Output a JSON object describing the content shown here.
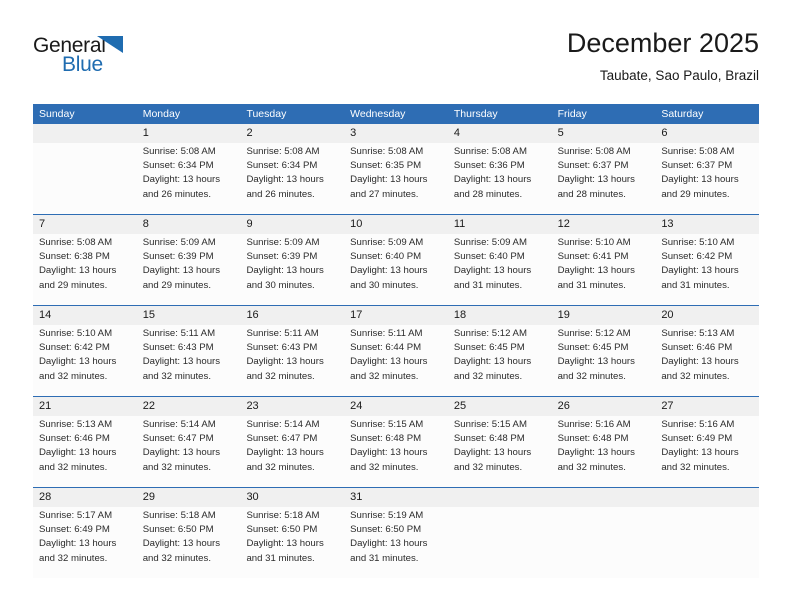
{
  "logo": {
    "word_top": "General",
    "word_bottom": "Blue",
    "triangle_icon": "triangle-icon",
    "color": "#1f6cb0"
  },
  "header": {
    "title": "December 2025",
    "location": "Taubate, Sao Paulo, Brazil"
  },
  "theme": {
    "accent": "#2e6db4",
    "daynum_band": "#f0f0f0",
    "cell_bg": "#fcfcfc",
    "header_text": "#ffffff"
  },
  "calendar": {
    "weekdays": [
      "Sunday",
      "Monday",
      "Tuesday",
      "Wednesday",
      "Thursday",
      "Friday",
      "Saturday"
    ],
    "weeks": [
      [
        {
          "day": "",
          "lines": []
        },
        {
          "day": "1",
          "lines": [
            "Sunrise: 5:08 AM",
            "Sunset: 6:34 PM",
            "Daylight: 13 hours",
            "and 26 minutes."
          ]
        },
        {
          "day": "2",
          "lines": [
            "Sunrise: 5:08 AM",
            "Sunset: 6:34 PM",
            "Daylight: 13 hours",
            "and 26 minutes."
          ]
        },
        {
          "day": "3",
          "lines": [
            "Sunrise: 5:08 AM",
            "Sunset: 6:35 PM",
            "Daylight: 13 hours",
            "and 27 minutes."
          ]
        },
        {
          "day": "4",
          "lines": [
            "Sunrise: 5:08 AM",
            "Sunset: 6:36 PM",
            "Daylight: 13 hours",
            "and 28 minutes."
          ]
        },
        {
          "day": "5",
          "lines": [
            "Sunrise: 5:08 AM",
            "Sunset: 6:37 PM",
            "Daylight: 13 hours",
            "and 28 minutes."
          ]
        },
        {
          "day": "6",
          "lines": [
            "Sunrise: 5:08 AM",
            "Sunset: 6:37 PM",
            "Daylight: 13 hours",
            "and 29 minutes."
          ]
        }
      ],
      [
        {
          "day": "7",
          "lines": [
            "Sunrise: 5:08 AM",
            "Sunset: 6:38 PM",
            "Daylight: 13 hours",
            "and 29 minutes."
          ]
        },
        {
          "day": "8",
          "lines": [
            "Sunrise: 5:09 AM",
            "Sunset: 6:39 PM",
            "Daylight: 13 hours",
            "and 29 minutes."
          ]
        },
        {
          "day": "9",
          "lines": [
            "Sunrise: 5:09 AM",
            "Sunset: 6:39 PM",
            "Daylight: 13 hours",
            "and 30 minutes."
          ]
        },
        {
          "day": "10",
          "lines": [
            "Sunrise: 5:09 AM",
            "Sunset: 6:40 PM",
            "Daylight: 13 hours",
            "and 30 minutes."
          ]
        },
        {
          "day": "11",
          "lines": [
            "Sunrise: 5:09 AM",
            "Sunset: 6:40 PM",
            "Daylight: 13 hours",
            "and 31 minutes."
          ]
        },
        {
          "day": "12",
          "lines": [
            "Sunrise: 5:10 AM",
            "Sunset: 6:41 PM",
            "Daylight: 13 hours",
            "and 31 minutes."
          ]
        },
        {
          "day": "13",
          "lines": [
            "Sunrise: 5:10 AM",
            "Sunset: 6:42 PM",
            "Daylight: 13 hours",
            "and 31 minutes."
          ]
        }
      ],
      [
        {
          "day": "14",
          "lines": [
            "Sunrise: 5:10 AM",
            "Sunset: 6:42 PM",
            "Daylight: 13 hours",
            "and 32 minutes."
          ]
        },
        {
          "day": "15",
          "lines": [
            "Sunrise: 5:11 AM",
            "Sunset: 6:43 PM",
            "Daylight: 13 hours",
            "and 32 minutes."
          ]
        },
        {
          "day": "16",
          "lines": [
            "Sunrise: 5:11 AM",
            "Sunset: 6:43 PM",
            "Daylight: 13 hours",
            "and 32 minutes."
          ]
        },
        {
          "day": "17",
          "lines": [
            "Sunrise: 5:11 AM",
            "Sunset: 6:44 PM",
            "Daylight: 13 hours",
            "and 32 minutes."
          ]
        },
        {
          "day": "18",
          "lines": [
            "Sunrise: 5:12 AM",
            "Sunset: 6:45 PM",
            "Daylight: 13 hours",
            "and 32 minutes."
          ]
        },
        {
          "day": "19",
          "lines": [
            "Sunrise: 5:12 AM",
            "Sunset: 6:45 PM",
            "Daylight: 13 hours",
            "and 32 minutes."
          ]
        },
        {
          "day": "20",
          "lines": [
            "Sunrise: 5:13 AM",
            "Sunset: 6:46 PM",
            "Daylight: 13 hours",
            "and 32 minutes."
          ]
        }
      ],
      [
        {
          "day": "21",
          "lines": [
            "Sunrise: 5:13 AM",
            "Sunset: 6:46 PM",
            "Daylight: 13 hours",
            "and 32 minutes."
          ]
        },
        {
          "day": "22",
          "lines": [
            "Sunrise: 5:14 AM",
            "Sunset: 6:47 PM",
            "Daylight: 13 hours",
            "and 32 minutes."
          ]
        },
        {
          "day": "23",
          "lines": [
            "Sunrise: 5:14 AM",
            "Sunset: 6:47 PM",
            "Daylight: 13 hours",
            "and 32 minutes."
          ]
        },
        {
          "day": "24",
          "lines": [
            "Sunrise: 5:15 AM",
            "Sunset: 6:48 PM",
            "Daylight: 13 hours",
            "and 32 minutes."
          ]
        },
        {
          "day": "25",
          "lines": [
            "Sunrise: 5:15 AM",
            "Sunset: 6:48 PM",
            "Daylight: 13 hours",
            "and 32 minutes."
          ]
        },
        {
          "day": "26",
          "lines": [
            "Sunrise: 5:16 AM",
            "Sunset: 6:48 PM",
            "Daylight: 13 hours",
            "and 32 minutes."
          ]
        },
        {
          "day": "27",
          "lines": [
            "Sunrise: 5:16 AM",
            "Sunset: 6:49 PM",
            "Daylight: 13 hours",
            "and 32 minutes."
          ]
        }
      ],
      [
        {
          "day": "28",
          "lines": [
            "Sunrise: 5:17 AM",
            "Sunset: 6:49 PM",
            "Daylight: 13 hours",
            "and 32 minutes."
          ]
        },
        {
          "day": "29",
          "lines": [
            "Sunrise: 5:18 AM",
            "Sunset: 6:50 PM",
            "Daylight: 13 hours",
            "and 32 minutes."
          ]
        },
        {
          "day": "30",
          "lines": [
            "Sunrise: 5:18 AM",
            "Sunset: 6:50 PM",
            "Daylight: 13 hours",
            "and 31 minutes."
          ]
        },
        {
          "day": "31",
          "lines": [
            "Sunrise: 5:19 AM",
            "Sunset: 6:50 PM",
            "Daylight: 13 hours",
            "and 31 minutes."
          ]
        },
        {
          "day": "",
          "lines": []
        },
        {
          "day": "",
          "lines": []
        },
        {
          "day": "",
          "lines": []
        }
      ]
    ]
  }
}
